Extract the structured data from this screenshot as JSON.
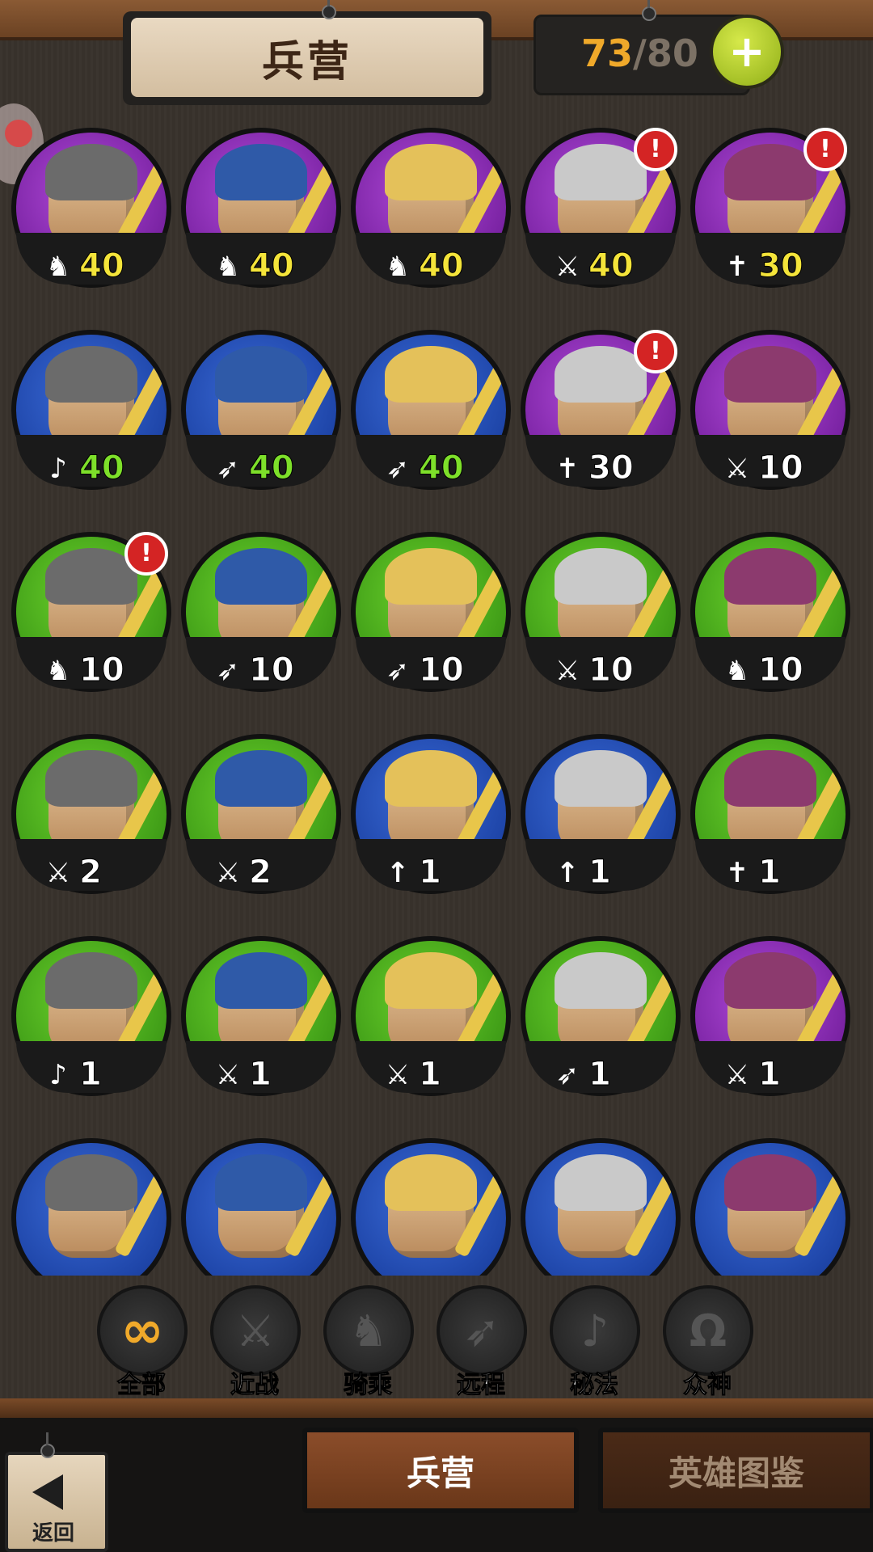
{
  "header": {
    "title": "兵营",
    "capacity_current": "73",
    "capacity_separator": "/",
    "capacity_max": "80",
    "add_button_label": "+"
  },
  "units": [
    {
      "frame": "purple",
      "class_icon": "cavalry-icon",
      "glyph": "♞",
      "level": "40",
      "level_color": "yellow",
      "alert": false
    },
    {
      "frame": "purple",
      "class_icon": "cavalry-icon",
      "glyph": "♞",
      "level": "40",
      "level_color": "yellow",
      "alert": false
    },
    {
      "frame": "purple",
      "class_icon": "cavalry-icon",
      "glyph": "♞",
      "level": "40",
      "level_color": "yellow",
      "alert": false
    },
    {
      "frame": "purple",
      "class_icon": "sword-icon",
      "glyph": "⚔",
      "level": "40",
      "level_color": "yellow",
      "alert": true
    },
    {
      "frame": "purple",
      "class_icon": "divine-icon",
      "glyph": "✝",
      "level": "30",
      "level_color": "yellow",
      "alert": true
    },
    {
      "frame": "blue",
      "class_icon": "arcane-icon",
      "glyph": "♪",
      "level": "40",
      "level_color": "green",
      "alert": false
    },
    {
      "frame": "blue",
      "class_icon": "bow-icon",
      "glyph": "➶",
      "level": "40",
      "level_color": "green",
      "alert": false
    },
    {
      "frame": "blue",
      "class_icon": "bow-icon",
      "glyph": "➶",
      "level": "40",
      "level_color": "green",
      "alert": false
    },
    {
      "frame": "purple",
      "class_icon": "divine-icon",
      "glyph": "✝",
      "level": "30",
      "level_color": "white",
      "alert": true
    },
    {
      "frame": "purple",
      "class_icon": "sword-icon",
      "glyph": "⚔",
      "level": "10",
      "level_color": "white",
      "alert": false
    },
    {
      "frame": "green",
      "class_icon": "cavalry-icon",
      "glyph": "♞",
      "level": "10",
      "level_color": "white",
      "alert": true
    },
    {
      "frame": "green",
      "class_icon": "bow-icon",
      "glyph": "➶",
      "level": "10",
      "level_color": "white",
      "alert": false
    },
    {
      "frame": "green",
      "class_icon": "bow-icon",
      "glyph": "➶",
      "level": "10",
      "level_color": "white",
      "alert": false
    },
    {
      "frame": "green",
      "class_icon": "sword-icon",
      "glyph": "⚔",
      "level": "10",
      "level_color": "white",
      "alert": false
    },
    {
      "frame": "green",
      "class_icon": "cavalry-icon",
      "glyph": "♞",
      "level": "10",
      "level_color": "white",
      "alert": false
    },
    {
      "frame": "green",
      "class_icon": "sword-icon",
      "glyph": "⚔",
      "level": "2",
      "level_color": "white",
      "alert": false
    },
    {
      "frame": "green",
      "class_icon": "sword-icon",
      "glyph": "⚔",
      "level": "2",
      "level_color": "white",
      "alert": false
    },
    {
      "frame": "blue",
      "class_icon": "spear-icon",
      "glyph": "↑",
      "level": "1",
      "level_color": "white",
      "alert": false
    },
    {
      "frame": "blue",
      "class_icon": "spear-icon",
      "glyph": "↑",
      "level": "1",
      "level_color": "white",
      "alert": false
    },
    {
      "frame": "green",
      "class_icon": "divine-icon",
      "glyph": "✝",
      "level": "1",
      "level_color": "white",
      "alert": false
    },
    {
      "frame": "green",
      "class_icon": "arcane-icon",
      "glyph": "♪",
      "level": "1",
      "level_color": "white",
      "alert": false
    },
    {
      "frame": "green",
      "class_icon": "sword-icon",
      "glyph": "⚔",
      "level": "1",
      "level_color": "white",
      "alert": false
    },
    {
      "frame": "green",
      "class_icon": "sword-icon",
      "glyph": "⚔",
      "level": "1",
      "level_color": "white",
      "alert": false
    },
    {
      "frame": "green",
      "class_icon": "bow-icon",
      "glyph": "➶",
      "level": "1",
      "level_color": "white",
      "alert": false
    },
    {
      "frame": "purple",
      "class_icon": "sword-icon",
      "glyph": "⚔",
      "level": "1",
      "level_color": "white",
      "alert": false
    },
    {
      "frame": "blue",
      "class_icon": "",
      "glyph": "",
      "level": "",
      "level_color": "white",
      "alert": false
    },
    {
      "frame": "blue",
      "class_icon": "",
      "glyph": "",
      "level": "",
      "level_color": "white",
      "alert": false
    },
    {
      "frame": "blue",
      "class_icon": "",
      "glyph": "",
      "level": "",
      "level_color": "white",
      "alert": false
    },
    {
      "frame": "blue",
      "class_icon": "",
      "glyph": "",
      "level": "",
      "level_color": "white",
      "alert": false
    },
    {
      "frame": "blue",
      "class_icon": "",
      "glyph": "",
      "level": "",
      "level_color": "white",
      "alert": false
    }
  ],
  "alert_glyph": "!",
  "filters": [
    {
      "label": "全部",
      "icon": "infinity-icon",
      "glyph": "∞",
      "active": true
    },
    {
      "label": "近战",
      "icon": "sword-icon",
      "glyph": "⚔",
      "active": false
    },
    {
      "label": "骑乘",
      "icon": "horse-icon",
      "glyph": "♞",
      "active": false
    },
    {
      "label": "远程",
      "icon": "bow-icon",
      "glyph": "➶",
      "active": false
    },
    {
      "label": "秘法",
      "icon": "arcane-icon",
      "glyph": "♪",
      "active": false
    },
    {
      "label": "众神",
      "icon": "omega-icon",
      "glyph": "Ω",
      "active": false
    }
  ],
  "tabs": {
    "barracks": "兵营",
    "hero_codex": "英雄图鉴"
  },
  "back_label": "返回",
  "colors": {
    "purple": "#7a23a3",
    "blue": "#1e45a8",
    "green": "#3f9c17",
    "level_yellow": "#f4e43a",
    "level_green": "#7ee02a",
    "accent_orange": "#f0a92a"
  }
}
